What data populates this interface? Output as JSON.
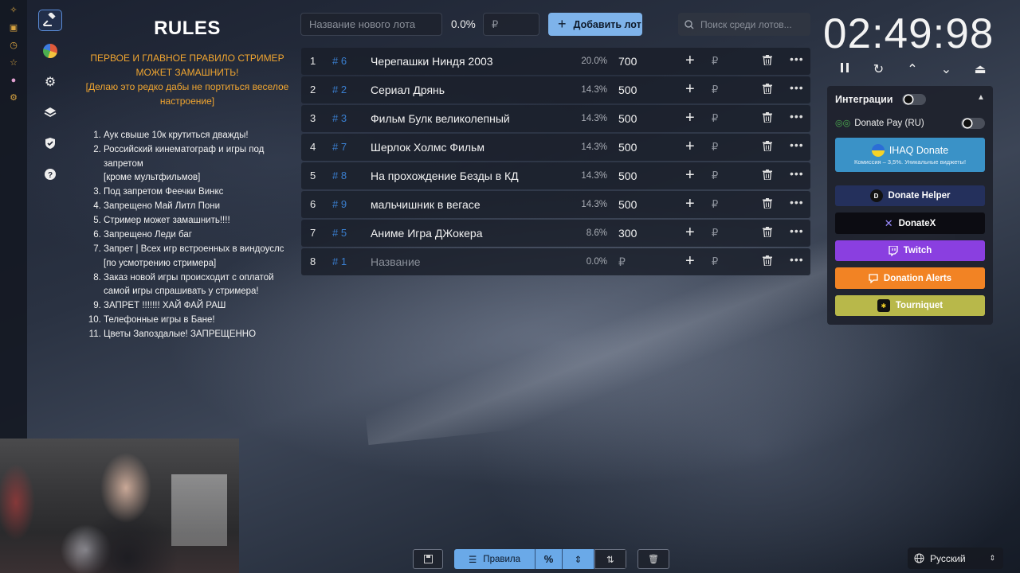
{
  "sidebar_strip": {
    "icons": [
      "sparkle-icon",
      "archive-icon",
      "clock-icon",
      "star-icon",
      "palette-icon",
      "cog-icon"
    ]
  },
  "nav": {
    "items": [
      "auction-hammer-icon",
      "pie-chart-icon",
      "gear-icon",
      "layers-icon",
      "shield-icon",
      "help-icon"
    ]
  },
  "rules": {
    "title": "RULES",
    "main_rule_line1": "ПЕРВОЕ И ГЛАВНОЕ ПРАВИЛО СТРИМЕР",
    "main_rule_line2": "МОЖЕТ ЗАМАШНИТЬ!",
    "main_rule_line3": "[Делаю это редко дабы не портиться веселое",
    "main_rule_line4": "настроение]",
    "items": [
      "Аук свыше 10к крутиться дважды!",
      "Российский кинематограф и игры  под запретом",
      "[кроме мультфильмов]",
      "Под запретом Феечки Винкс",
      "Запрещено Май Литл Пони",
      "Стример может замашнить!!!!",
      "Запрещено Леди баг",
      "Запрет | Всех игр встроенных в виндоуслс",
      "[по усмотрению стримера]",
      "Заказ новой игры происходит с оплатой самой игры спрашивать у стримера!",
      "ЗАПРЕТ !!!!!!! ХАЙ ФАЙ РАШ",
      "Телефонные игры в Бане!",
      "Цветы Запоздалые! ЗАПРЕЩЕННО"
    ]
  },
  "topbar": {
    "lot_name_placeholder": "Название нового лота",
    "pct": "0.0%",
    "rub_placeholder": "₽",
    "add_label": "Добавить лот",
    "search_placeholder": "Поиск среди лотов..."
  },
  "lots": [
    {
      "idx": "1",
      "id": "# 6",
      "name": "Черепашки Ниндя 2003",
      "pct": "20.0%",
      "amount": "700"
    },
    {
      "idx": "2",
      "id": "# 2",
      "name": "Сериал Дрянь",
      "pct": "14.3%",
      "amount": "500"
    },
    {
      "idx": "3",
      "id": "# 3",
      "name": "Фильм Булк великолепный",
      "pct": "14.3%",
      "amount": "500"
    },
    {
      "idx": "4",
      "id": "# 7",
      "name": "Шерлок Холмс Фильм",
      "pct": "14.3%",
      "amount": "500"
    },
    {
      "idx": "5",
      "id": "# 8",
      "name": "На прохождение Безды в КД",
      "pct": "14.3%",
      "amount": "500"
    },
    {
      "idx": "6",
      "id": "# 9",
      "name": "мальчишник в вегасе",
      "pct": "14.3%",
      "amount": "500"
    },
    {
      "idx": "7",
      "id": "# 5",
      "name": "Аниме Игра ДЖокера",
      "pct": "8.6%",
      "amount": "300"
    },
    {
      "idx": "8",
      "id": "# 1",
      "name": "Название",
      "pct": "0.0%",
      "amount": "₽"
    }
  ],
  "lot_rub": "₽",
  "timer": {
    "value": "02:49:98"
  },
  "integrations": {
    "title": "Интеграции",
    "donate_pay": "Donate Pay (RU)",
    "ihaq_title": "IHAQ Donate",
    "ihaq_sub": "Комиссия – 3,5%. Уникальные виджеты!",
    "donate_helper": "Donate Helper",
    "donatex": "DonateX",
    "twitch": "Twitch",
    "donation_alerts": "Donation Alerts",
    "tourniquet": "Tourniquet"
  },
  "bottom": {
    "rules_label": "Правила",
    "pct_symbol": "%"
  },
  "language": {
    "selected": "Русский"
  },
  "colors": {
    "accent": "#7eb3ea",
    "rules_main": "#f0a530",
    "lot_id": "#3a7fd0"
  }
}
